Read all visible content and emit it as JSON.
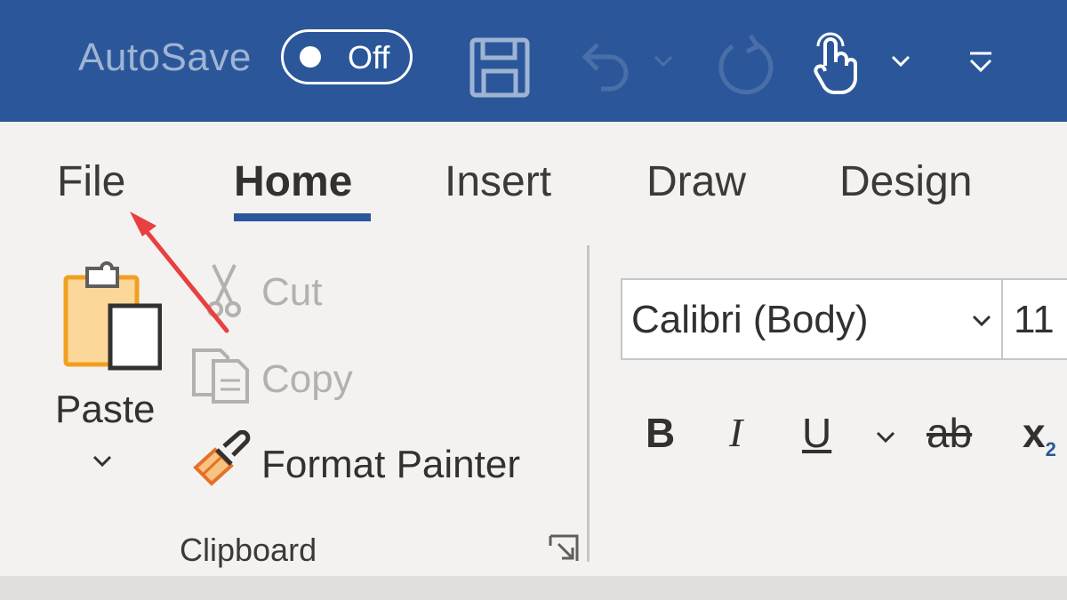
{
  "quick_access": {
    "autosave_label": "AutoSave",
    "autosave_state": "Off",
    "icons": [
      "save-icon",
      "undo-icon",
      "undo-dropdown-icon",
      "redo-icon",
      "touch-mode-icon",
      "touch-dropdown-icon",
      "customize-toolbar-icon"
    ]
  },
  "tabs": [
    {
      "label": "File"
    },
    {
      "label": "Home",
      "active": true
    },
    {
      "label": "Insert"
    },
    {
      "label": "Draw"
    },
    {
      "label": "Design"
    }
  ],
  "clipboard": {
    "paste_label": "Paste",
    "cut_label": "Cut",
    "copy_label": "Copy",
    "format_painter_label": "Format Painter",
    "group_label": "Clipboard"
  },
  "font": {
    "name": "Calibri (Body)",
    "size": "11",
    "bold_label": "B",
    "italic_label": "I",
    "underline_label": "U",
    "strikethrough_label": "ab",
    "subscript_label": "x",
    "subscript_index": "2"
  },
  "colors": {
    "title_bar": "#2b579a",
    "ribbon_bg": "#f3f2f1",
    "accent_underline": "#2b579a",
    "annotation_arrow": "#e8403f",
    "paste_orange": "#f0a020"
  }
}
